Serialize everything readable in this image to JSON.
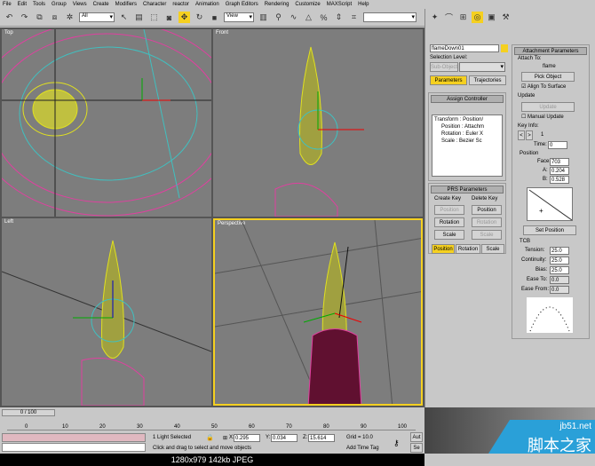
{
  "menu": [
    "File",
    "Edit",
    "Tools",
    "Group",
    "Views",
    "Create",
    "Modifiers",
    "Character",
    "reactor",
    "Animation",
    "Graph Editors",
    "Rendering",
    "Customize",
    "MAXScript",
    "Help"
  ],
  "toolbar": {
    "selection_filter": "All",
    "ref_coord": "View",
    "named_sel": ""
  },
  "viewports": {
    "top": "Top",
    "front": "Front",
    "left": "Left",
    "perspective": "Perspective"
  },
  "panel": {
    "object_name": "flameDown01",
    "object_color": "#f5d020",
    "selection_level_label": "Selection Level:",
    "sub_object": "Sub-Object",
    "tabs": [
      "Parameters",
      "Trajectories"
    ],
    "assign_controller": {
      "title": "Assign Controller",
      "tree": [
        "Transform : Position/",
        "Position : Attachm",
        "Rotation : Euler X",
        "Scale : Bezier Sc"
      ]
    },
    "prs": {
      "title": "PRS Parameters",
      "create_key": "Create Key",
      "delete_key": "Delete Key",
      "buttons": [
        "Position",
        "Rotation",
        "Scale"
      ],
      "bottom_tabs": [
        "Position",
        "Rotation",
        "Scale"
      ]
    },
    "attachment": {
      "title": "Attachment Parameters",
      "attach_to": "Attach To:",
      "target": "flame",
      "pick_object": "Pick Object",
      "align": "Align To Surface",
      "update_group": "Update",
      "update": "Update",
      "manual_update": "Manual Update",
      "key_info": "Key Info:",
      "key_num": "1",
      "time_label": "Time:",
      "time": "0",
      "position": "Position",
      "face_label": "Face:",
      "face": "703",
      "a_label": "A:",
      "a": "0.204",
      "b_label": "B:",
      "b": "0.528",
      "set_position": "Set Position",
      "tcb": "TCB",
      "tension_label": "Tension:",
      "tension": "25.0",
      "continuity_label": "Continuity:",
      "continuity": "25.0",
      "bias_label": "Bias:",
      "bias": "25.0",
      "ease_to_label": "Ease To:",
      "ease_to": "0.0",
      "ease_from_label": "Ease From:",
      "ease_from": "0.0"
    }
  },
  "timeline": {
    "frame": "0 / 100",
    "ticks": [
      "0",
      "10",
      "20",
      "30",
      "40",
      "50",
      "60",
      "70",
      "80",
      "90",
      "100"
    ]
  },
  "status": {
    "selected": "1 Light Selected",
    "x_label": "X:",
    "x": "0.295",
    "y_label": "Y:",
    "y": "0.034",
    "z_label": "Z:",
    "z": "15.614",
    "grid": "Grid = 10.0",
    "prompt": "Click and drag to select and move objects",
    "add_time_tag": "Add Time Tag",
    "auto": "Aut",
    "set": "Se"
  },
  "caption": "1280x979  142kb  JPEG",
  "watermark": {
    "site": "jb51.net",
    "name": "脚本之家"
  }
}
